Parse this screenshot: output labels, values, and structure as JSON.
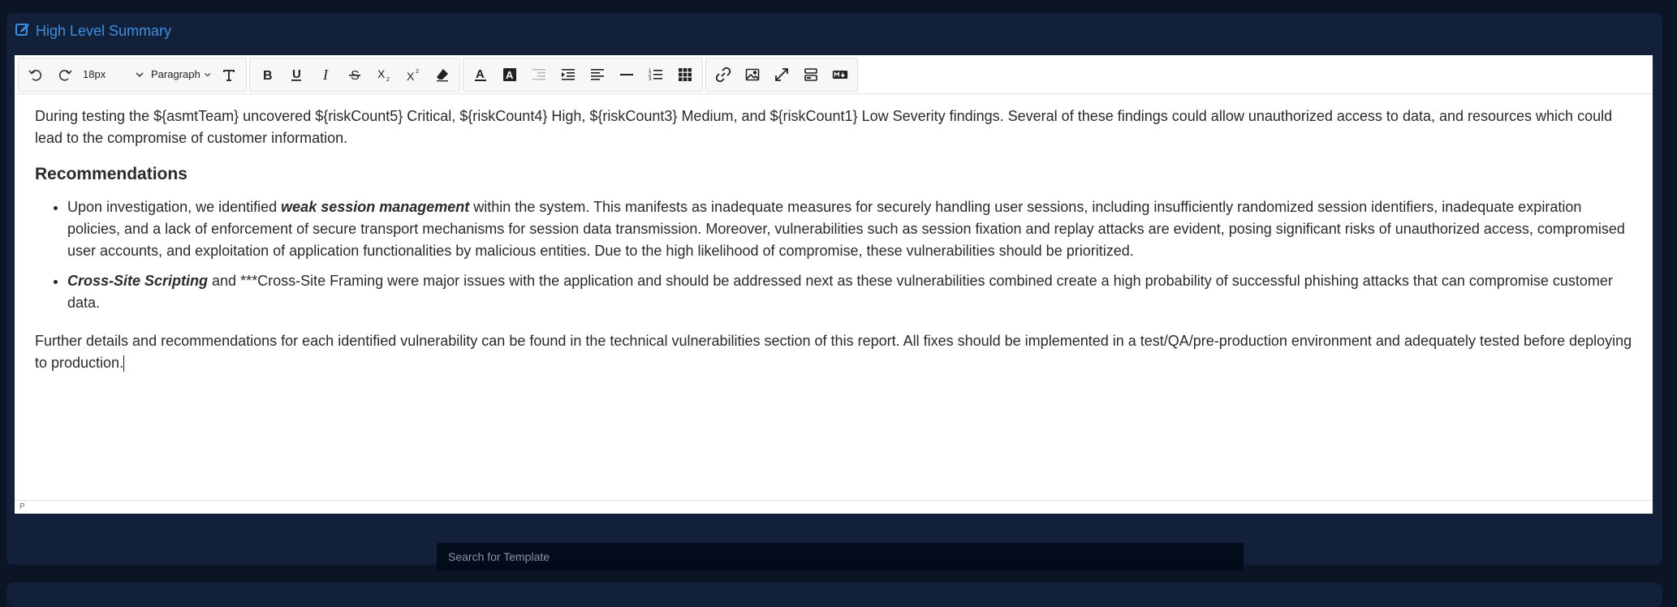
{
  "panel": {
    "title": "High Level Summary",
    "title_icon": "edit-icon",
    "accent_color": "#3d8fe0"
  },
  "toolbar": {
    "font_size": "18px",
    "block_format": "Paragraph",
    "buttons": [
      "undo",
      "redo",
      "clear-format-text",
      "bold",
      "underline",
      "italic",
      "strikethrough",
      "subscript",
      "superscript",
      "eraser",
      "font-color",
      "background-color",
      "outdent",
      "indent",
      "align-left",
      "horizontal-rule",
      "ordered-list",
      "table",
      "link",
      "image",
      "fullscreen",
      "show-blocks",
      "markdown"
    ]
  },
  "content": {
    "para1": "During testing the ${asmtTeam} uncovered ${riskCount5} Critical, ${riskCount4} High, ${riskCount3} Medium, and ${riskCount1} Low Severity findings. Several of these findings could allow unauthorized access to data, and resources which could lead to the compromise of customer information.",
    "heading": "Recommendations",
    "bullet1_pre": "Upon investigation, we identified ",
    "bullet1_em": "weak session management",
    "bullet1_post": " within the system. This manifests as inadequate measures for securely handling user sessions, including insufficiently randomized session identifiers, inadequate expiration policies, and a lack of enforcement of secure transport mechanisms for session data transmission. Moreover, vulnerabilities such as session fixation and replay attacks are evident, posing significant risks of unauthorized access, compromised user accounts, and exploitation of application functionalities by malicious entities. Due to the high likelihood of compromise, these vulnerabilities should be prioritized.",
    "bullet2_em": "Cross-Site Scripting",
    "bullet2_post": " and ***Cross-Site Framing were major issues with the application and should be addressed next as these vulnerabilities combined create a high probability of successful phishing attacks that can compromise customer data.",
    "para2": "Further details and recommendations for each identified vulnerability can be found in the technical vulnerabilities section of this report. All fixes should be implemented in a test/QA/pre-production environment and adequately tested before deploying to production."
  },
  "statusbar": {
    "path": "P"
  },
  "search": {
    "placeholder": "Search for Template"
  }
}
